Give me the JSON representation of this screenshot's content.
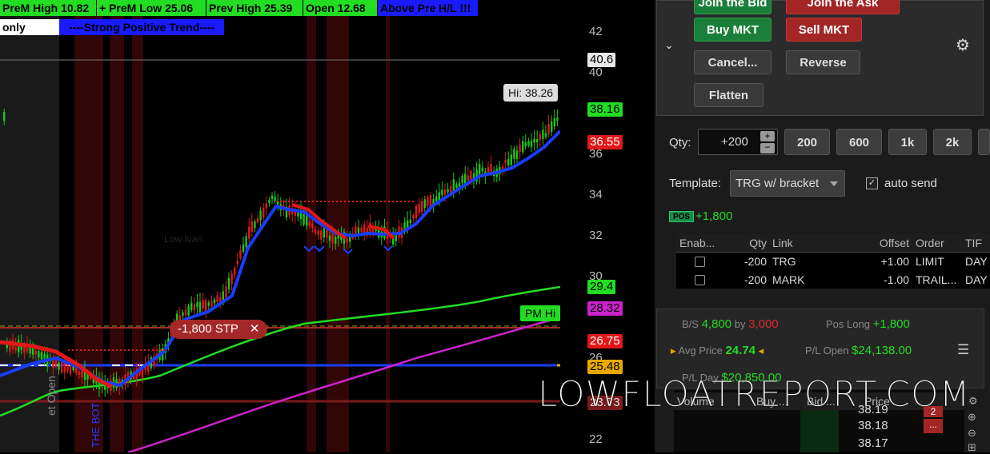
{
  "banner": {
    "premarket_high": "PreM High 10.82",
    "premarket_low": "+ PreM Low 25.06",
    "prev_high": "Prev High 25.39",
    "open": "Open 12.68",
    "above_pre": "Above Pre H/L !!!",
    "only": "only",
    "trend": "----Strong Positive Trend----"
  },
  "chart": {
    "price_labels": [
      "42",
      "40",
      "36",
      "34",
      "32",
      "30",
      "26",
      "22"
    ],
    "hi_label": "Hi: 38.26",
    "tags": {
      "line_40": "40.6",
      "last": "38.16",
      "bid": "36.55",
      "pink": "28.32",
      "stop": "26.75",
      "blue": "25.48",
      "low": "23.73"
    },
    "small_tag": "29.4",
    "pm_hi": "PM Hi",
    "stop_order": "-1,800 STP",
    "stop_close": "✕",
    "vertical_text": "et Open",
    "vertical_text2": "THE BOT",
    "faint_label": "Low Ivan",
    "colors": {
      "up": "#18c818",
      "down": "#e01818",
      "ema": "#1a3cff",
      "trail": "#e01818",
      "green_ma": "#22dd22",
      "pink_ma": "#cc22cc"
    }
  },
  "panel": {
    "join_bid": "Join the Bid",
    "join_ask": "Join the Ask",
    "buy_mkt": "Buy MKT",
    "sell_mkt": "Sell MKT",
    "cancel": "Cancel...",
    "reverse": "Reverse",
    "flatten": "Flatten",
    "qty_label": "Qty:",
    "qty_value": "+200",
    "qty_presets": [
      "200",
      "600",
      "1k",
      "2k"
    ],
    "template_label": "Template:",
    "template_value": "TRG w/ bracket",
    "auto_send": "auto send",
    "pos_badge": "POS",
    "pos_value": "+1,800",
    "table_headers": [
      "Enab...",
      "Qty",
      "Link",
      "Offset",
      "Order",
      "TIF"
    ],
    "table_rows": [
      [
        "",
        "-200",
        "TRG",
        "+1.00",
        "LIMIT",
        "DAY"
      ],
      [
        "",
        "-200",
        "MARK",
        "-1.00",
        "TRAIL...",
        "DAY"
      ]
    ],
    "bs_label": "B/S",
    "bs_buy": "4,800",
    "bs_by": "by",
    "bs_sell": "3,000",
    "pos_long_label": "Pos Long",
    "pos_long_value": "+1,800",
    "avg_price_label": "Avg Price",
    "avg_price_value": "24.74",
    "pl_open_label": "P/L Open",
    "pl_open_value": "$24,138.00",
    "pl_day_label": "P/L Day",
    "pl_day_value": "$20,850.00",
    "ladder_headers": [
      "Volume",
      "Buy ...",
      "Bid ...",
      "Price"
    ],
    "ladder_prices": [
      "38.19",
      "38.18",
      "38.17"
    ],
    "ladder_ask": [
      "2",
      "..."
    ]
  },
  "watermark": "LOWFLOATREPORT.COM"
}
